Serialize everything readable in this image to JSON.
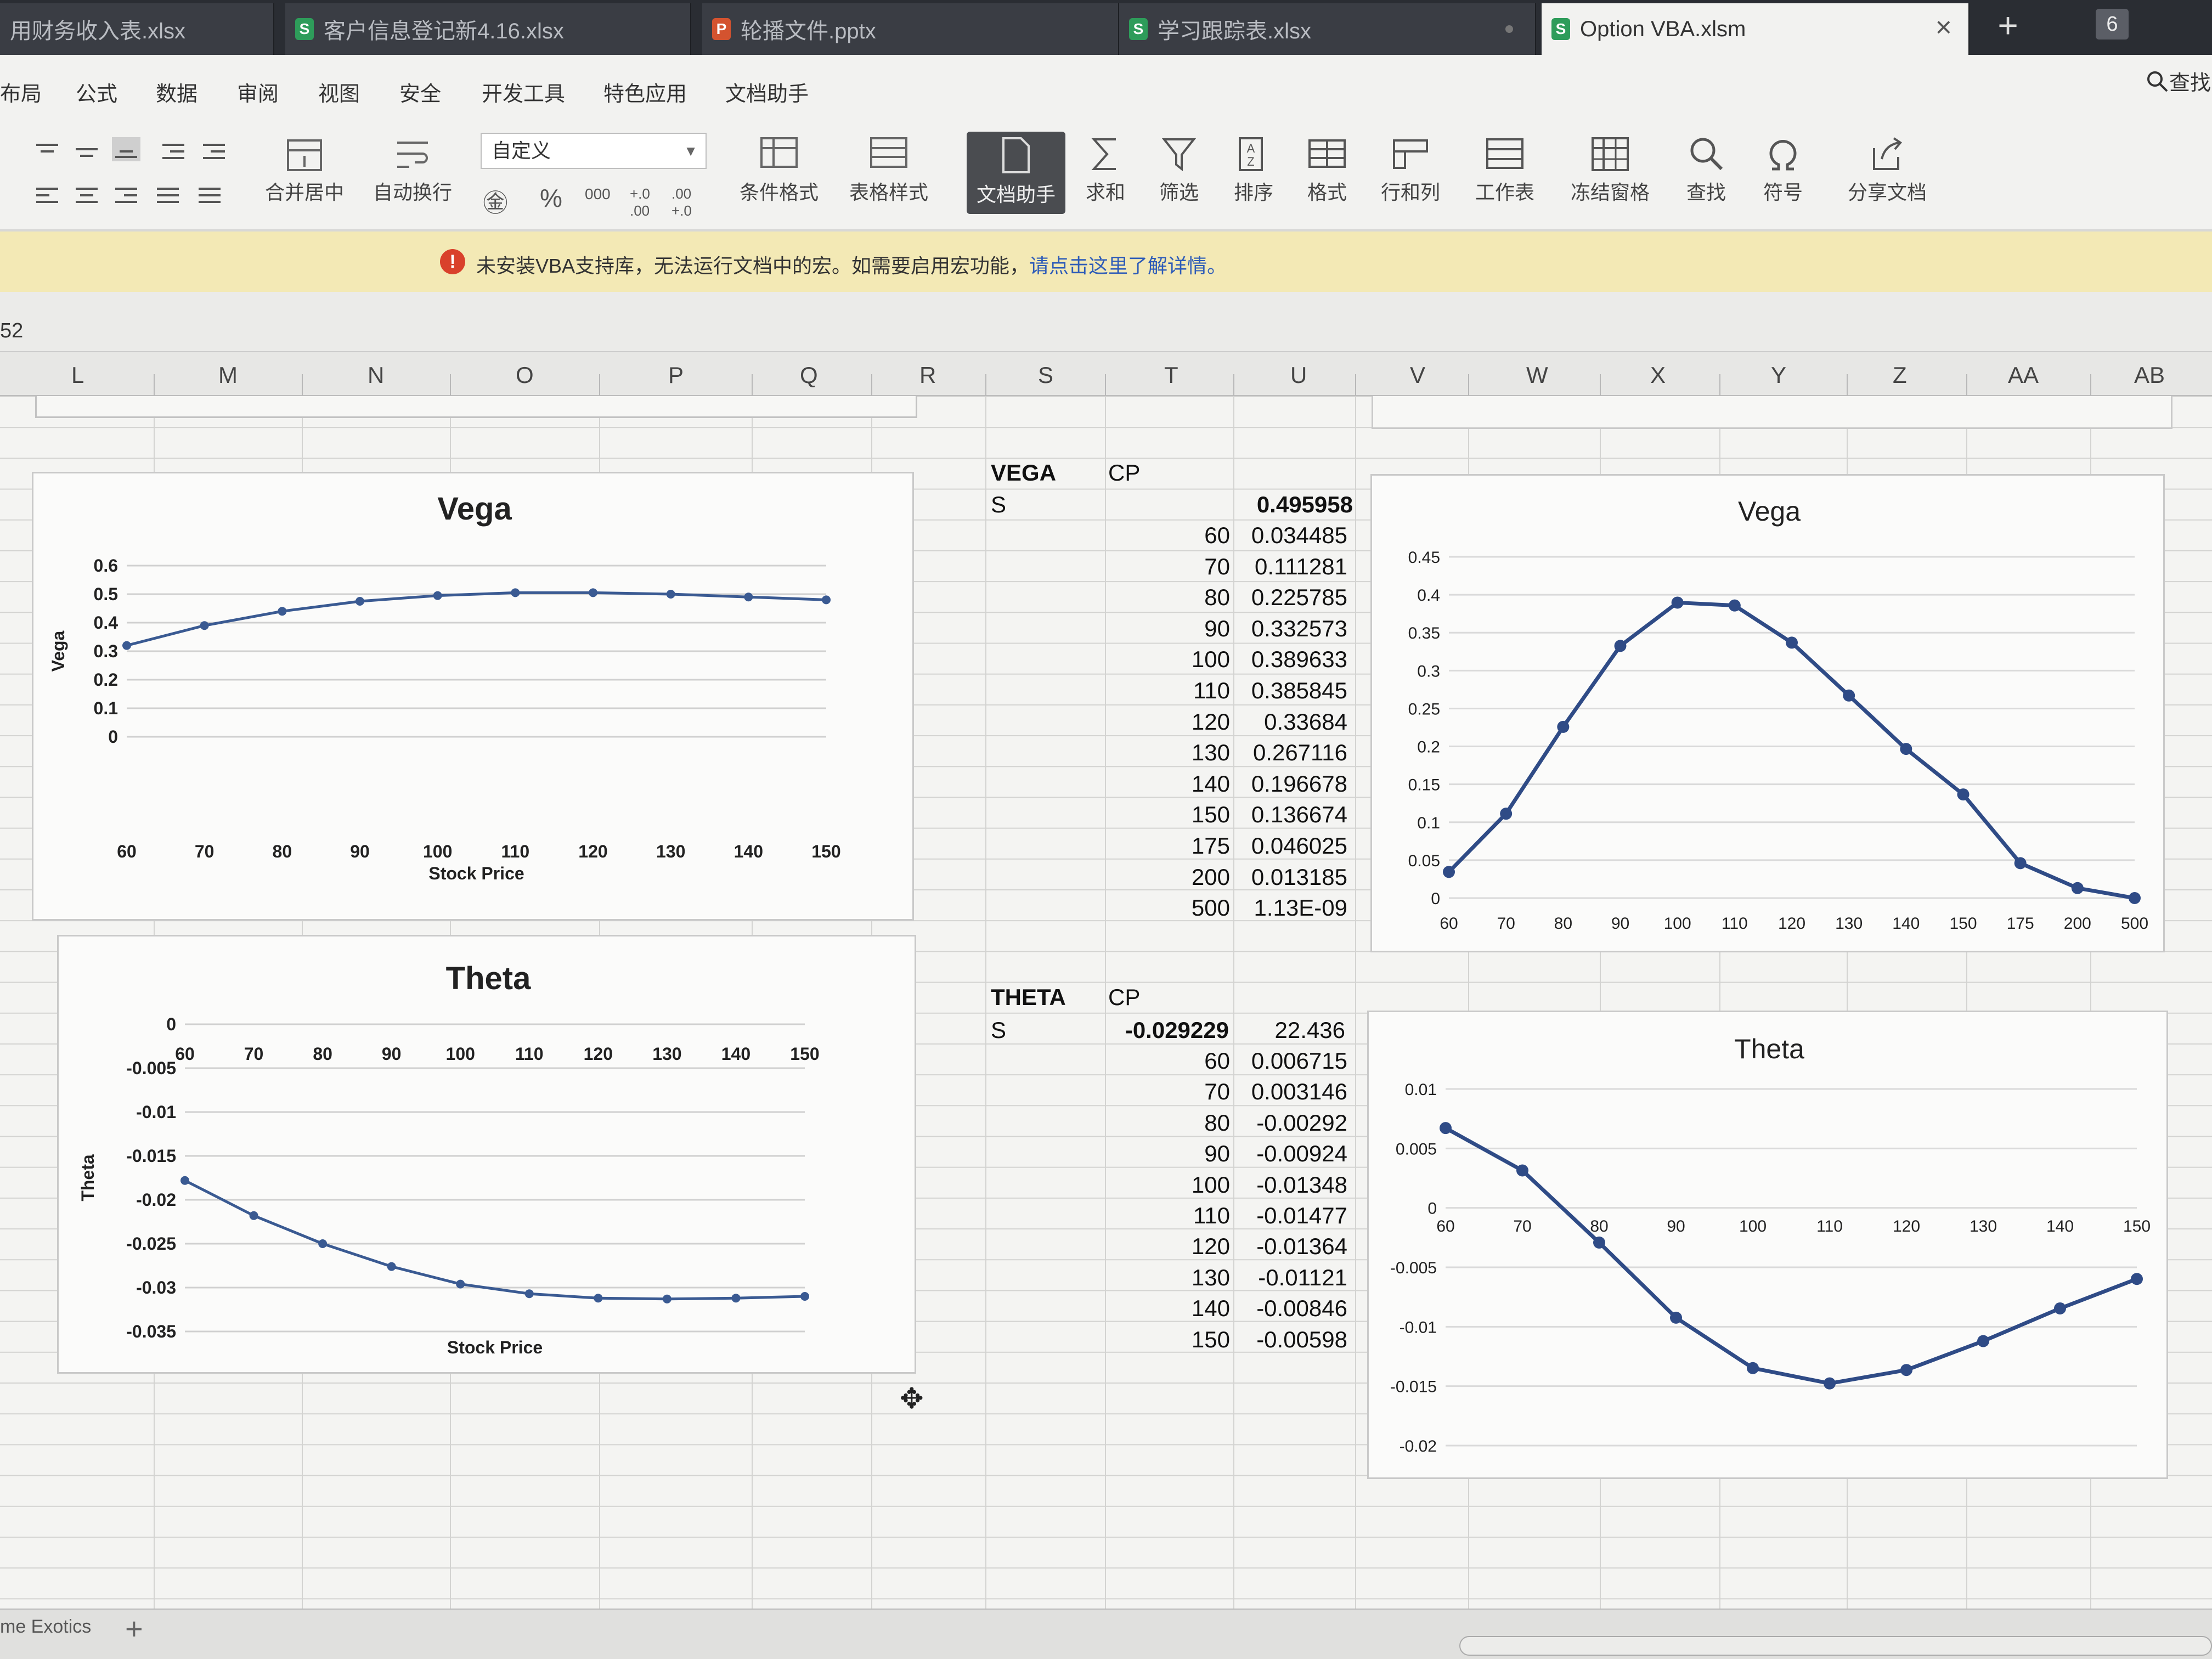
{
  "tabs": [
    {
      "label": "用财务收入表.xlsx",
      "icon": "S"
    },
    {
      "label": "客户信息登记新4.16.xlsx",
      "icon": "S"
    },
    {
      "label": "轮播文件.pptx",
      "icon": "P"
    },
    {
      "label": "学习跟踪表.xlsx",
      "icon": "S"
    },
    {
      "label": "Option VBA.xlsm",
      "icon": "S",
      "active": true
    }
  ],
  "tab_count": "6",
  "menu": [
    "布局",
    "公式",
    "数据",
    "审阅",
    "视图",
    "安全",
    "开发工具",
    "特色应用",
    "文档助手"
  ],
  "search_label": "查找",
  "toolbar": {
    "merge_center": "合并居中",
    "wrap_text": "自动换行",
    "number_format": "自定义",
    "percent_symbol": "%",
    "thousands_symbol": "000",
    "increase_decimal_symbol": "+.0 .00",
    "decrease_decimal_symbol": ".00 +.0",
    "conditional_format": "条件格式",
    "table_style": "表格样式",
    "doc_assistant": "文档助手",
    "sum": "求和",
    "filter": "筛选",
    "sort": "排序",
    "format": "格式",
    "row_col": "行和列",
    "worksheet": "工作表",
    "freeze": "冻结窗格",
    "find": "查找",
    "symbol": "符号",
    "share": "分享文档"
  },
  "warning": {
    "text": "未安装VBA支持库，无法运行文档中的宏。如需要启用宏功能，",
    "link": "请点击这里了解详情。"
  },
  "cell_ref": "52",
  "columns": [
    "L",
    "M",
    "N",
    "O",
    "P",
    "Q",
    "R",
    "S",
    "T",
    "U",
    "V",
    "W",
    "X",
    "Y",
    "Z",
    "AA",
    "AB"
  ],
  "vega_table": {
    "title": "VEGA",
    "cp": "CP",
    "s_label": "S",
    "header_value": "0.495958",
    "rows": [
      [
        "60",
        "0.034485"
      ],
      [
        "70",
        "0.111281"
      ],
      [
        "80",
        "0.225785"
      ],
      [
        "90",
        "0.332573"
      ],
      [
        "100",
        "0.389633"
      ],
      [
        "110",
        "0.385845"
      ],
      [
        "120",
        "0.33684"
      ],
      [
        "130",
        "0.267116"
      ],
      [
        "140",
        "0.196678"
      ],
      [
        "150",
        "0.136674"
      ],
      [
        "175",
        "0.046025"
      ],
      [
        "200",
        "0.013185"
      ],
      [
        "500",
        "1.13E-09"
      ]
    ]
  },
  "theta_table": {
    "title": "THETA",
    "cp": "CP",
    "s_label": "S",
    "header_cp_value": "-0.029229",
    "header_value": "22.436",
    "rows": [
      [
        "60",
        "0.006715"
      ],
      [
        "70",
        "0.003146"
      ],
      [
        "80",
        "-0.00292"
      ],
      [
        "90",
        "-0.00924"
      ],
      [
        "100",
        "-0.01348"
      ],
      [
        "110",
        "-0.01477"
      ],
      [
        "120",
        "-0.01364"
      ],
      [
        "130",
        "-0.01121"
      ],
      [
        "140",
        "-0.00846"
      ],
      [
        "150",
        "-0.00598"
      ]
    ]
  },
  "chart_data": [
    {
      "id": "vega-left",
      "type": "line",
      "title": "Vega",
      "xlabel": "Stock Price",
      "ylabel": "Vega",
      "categories": [
        "60",
        "70",
        "80",
        "90",
        "100",
        "110",
        "120",
        "130",
        "140",
        "150"
      ],
      "values": [
        0.32,
        0.39,
        0.44,
        0.475,
        0.495,
        0.505,
        0.505,
        0.5,
        0.49,
        0.48
      ],
      "ylim": [
        0,
        0.6
      ],
      "yticks": [
        "0",
        "0.1",
        "0.2",
        "0.3",
        "0.4",
        "0.5",
        "0.6"
      ],
      "color": "#3a5a92"
    },
    {
      "id": "theta-left",
      "type": "line",
      "title": "Theta",
      "xlabel": "Stock Price",
      "ylabel": "Theta",
      "categories": [
        "60",
        "70",
        "80",
        "90",
        "100",
        "110",
        "120",
        "130",
        "140",
        "150"
      ],
      "values": [
        -0.0178,
        -0.0218,
        -0.025,
        -0.0276,
        -0.0296,
        -0.0307,
        -0.0312,
        -0.0313,
        -0.0312,
        -0.031
      ],
      "ylim": [
        -0.035,
        0
      ],
      "yticks": [
        "0",
        "-0.005",
        "-0.01",
        "-0.015",
        "-0.02",
        "-0.025",
        "-0.03",
        "-0.035"
      ],
      "color": "#3a5a92"
    },
    {
      "id": "vega-right",
      "type": "line",
      "title": "Vega",
      "xlabel": "",
      "ylabel": "",
      "categories": [
        "60",
        "70",
        "80",
        "90",
        "100",
        "110",
        "120",
        "130",
        "140",
        "150",
        "175",
        "200",
        "500"
      ],
      "values": [
        0.034485,
        0.111281,
        0.225785,
        0.332573,
        0.389633,
        0.385845,
        0.33684,
        0.267116,
        0.196678,
        0.136674,
        0.046025,
        0.013185,
        0.0
      ],
      "ylim": [
        0,
        0.45
      ],
      "yticks": [
        "0",
        "0.05",
        "0.1",
        "0.15",
        "0.2",
        "0.25",
        "0.3",
        "0.35",
        "0.4",
        "0.45"
      ],
      "color": "#2f4b86"
    },
    {
      "id": "theta-right",
      "type": "line",
      "title": "Theta",
      "xlabel": "",
      "ylabel": "",
      "categories": [
        "60",
        "70",
        "80",
        "90",
        "100",
        "110",
        "120",
        "130",
        "140",
        "150"
      ],
      "values": [
        0.006715,
        0.003146,
        -0.00292,
        -0.00924,
        -0.01348,
        -0.01477,
        -0.01364,
        -0.01121,
        -0.00846,
        -0.00598
      ],
      "ylim": [
        -0.02,
        0.01
      ],
      "yticks": [
        "0.01",
        "0.005",
        "0",
        "-0.005",
        "-0.01",
        "-0.015",
        "-0.02"
      ],
      "color": "#2f4b86"
    }
  ],
  "sheet_tab": "me Exotics",
  "add_sheet_symbol": "+"
}
